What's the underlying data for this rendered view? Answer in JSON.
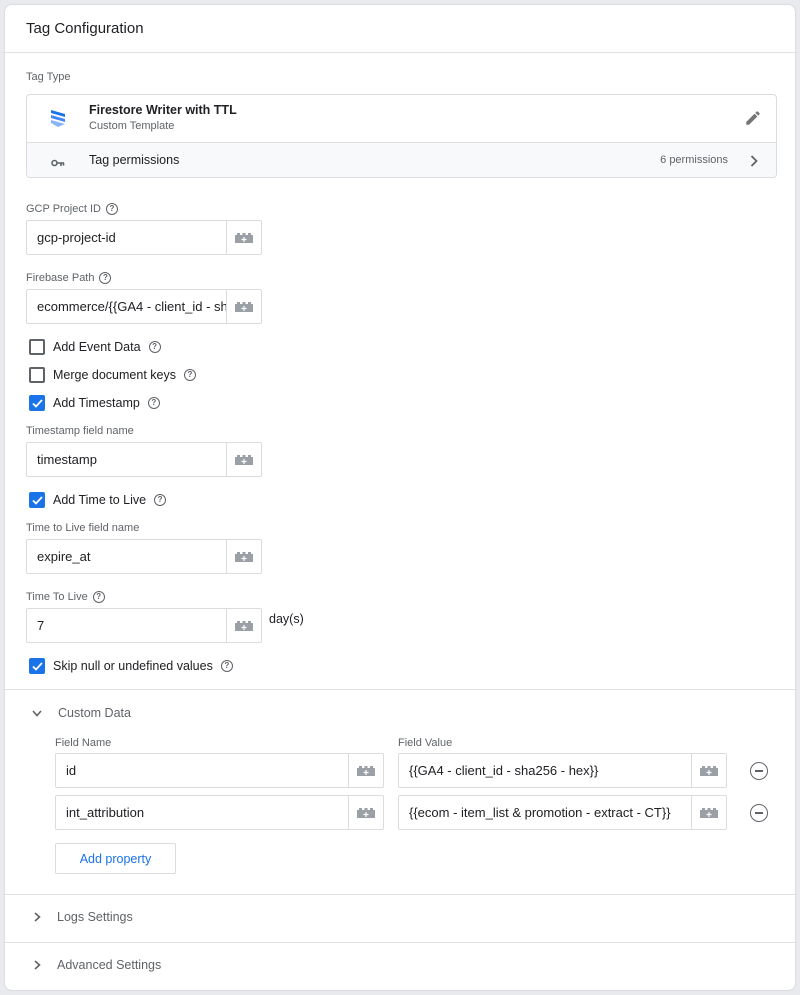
{
  "header": {
    "title": "Tag Configuration"
  },
  "tag_type": {
    "section_label": "Tag Type",
    "name": "Firestore Writer with TTL",
    "subtitle": "Custom Template",
    "permissions_label": "Tag permissions",
    "permissions_count": "6 permissions"
  },
  "fields": {
    "gcp_project_id": {
      "label": "GCP Project ID",
      "value": "gcp-project-id"
    },
    "firebase_path": {
      "label": "Firebase Path",
      "value": "ecommerce/{{GA4 - client_id - sh"
    },
    "timestamp_field": {
      "label": "Timestamp field name",
      "value": "timestamp"
    },
    "ttl_field": {
      "label": "Time to Live field name",
      "value": "expire_at"
    },
    "ttl": {
      "label": "Time To Live",
      "value": "7",
      "unit": "day(s)"
    }
  },
  "checkboxes": {
    "add_event_data": {
      "label": "Add Event Data",
      "checked": false
    },
    "merge_keys": {
      "label": "Merge document keys",
      "checked": false
    },
    "add_timestamp": {
      "label": "Add Timestamp",
      "checked": true
    },
    "add_ttl": {
      "label": "Add Time to Live",
      "checked": true
    },
    "skip_null": {
      "label": "Skip null or undefined values",
      "checked": true
    }
  },
  "custom_data": {
    "title": "Custom Data",
    "col_name": "Field Name",
    "col_value": "Field Value",
    "rows": [
      {
        "name": "id",
        "value": "{{GA4 - client_id - sha256 - hex}}"
      },
      {
        "name": "int_attribution",
        "value": "{{ecom - item_list & promotion - extract - CT}}"
      }
    ],
    "add_label": "Add property"
  },
  "sections": {
    "logs": "Logs Settings",
    "advanced": "Advanced Settings"
  },
  "colors": {
    "accent": "#1a73e8",
    "border": "#dadce0"
  }
}
